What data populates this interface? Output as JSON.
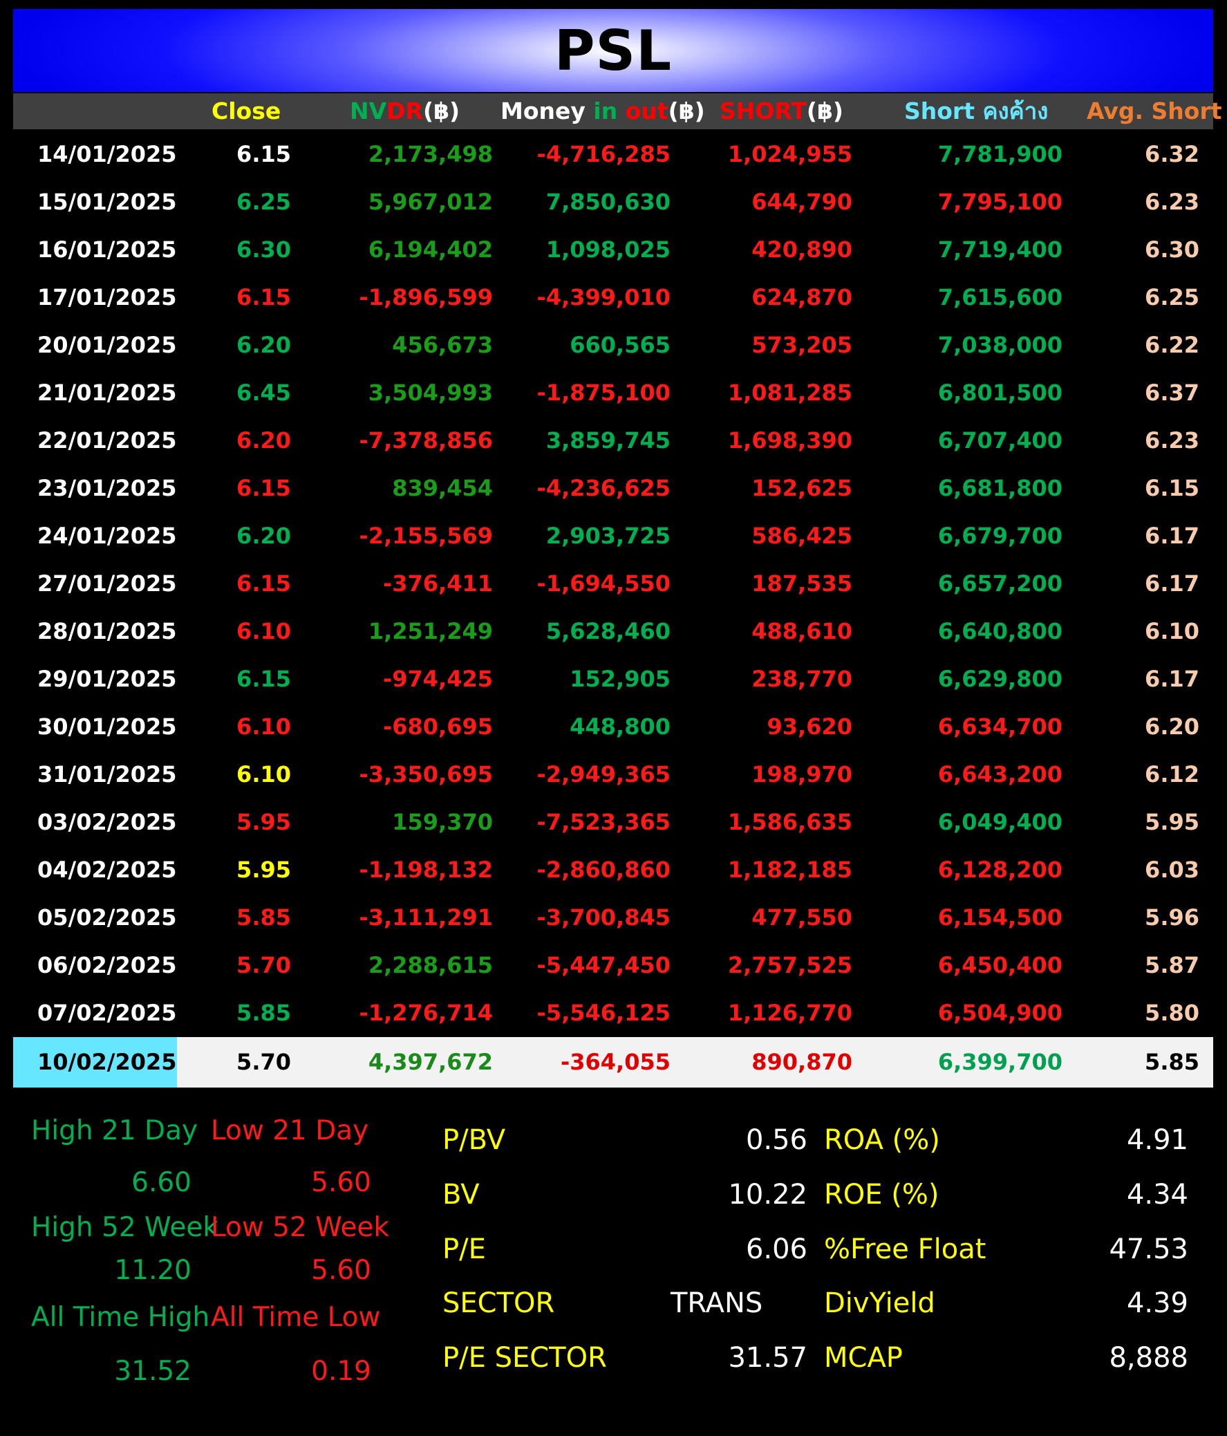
{
  "title": "PSL",
  "headers": {
    "close": "Close",
    "nvdr_a": "NV",
    "nvdr_b": "DR",
    "nvdr_c": "(฿)",
    "money_a": "Money ",
    "money_b": "in ",
    "money_c": "out",
    "money_d": "(฿)",
    "short_a": "SHORT",
    "short_b": "(฿)",
    "shortbal": "Short คงค้าง",
    "avg": "Avg. Short"
  },
  "rows": [
    {
      "date": "14/01/2025",
      "close": "6.15",
      "close_c": "w",
      "nvdr": "2,173,498",
      "nvdr_c": "g",
      "money": "-4,716,285",
      "money_c": "r",
      "short": "1,024,955",
      "shortbal": "7,781,900",
      "shortbal_c": "g",
      "avg": "6.32"
    },
    {
      "date": "15/01/2025",
      "close": "6.25",
      "close_c": "g",
      "nvdr": "5,967,012",
      "nvdr_c": "g",
      "money": "7,850,630",
      "money_c": "g",
      "short": "644,790",
      "shortbal": "7,795,100",
      "shortbal_c": "r",
      "avg": "6.23"
    },
    {
      "date": "16/01/2025",
      "close": "6.30",
      "close_c": "g",
      "nvdr": "6,194,402",
      "nvdr_c": "g",
      "money": "1,098,025",
      "money_c": "g",
      "short": "420,890",
      "shortbal": "7,719,400",
      "shortbal_c": "g",
      "avg": "6.30"
    },
    {
      "date": "17/01/2025",
      "close": "6.15",
      "close_c": "r",
      "nvdr": "-1,896,599",
      "nvdr_c": "r",
      "money": "-4,399,010",
      "money_c": "r",
      "short": "624,870",
      "shortbal": "7,615,600",
      "shortbal_c": "g",
      "avg": "6.25"
    },
    {
      "date": "20/01/2025",
      "close": "6.20",
      "close_c": "g",
      "nvdr": "456,673",
      "nvdr_c": "g",
      "money": "660,565",
      "money_c": "g",
      "short": "573,205",
      "shortbal": "7,038,000",
      "shortbal_c": "g",
      "avg": "6.22"
    },
    {
      "date": "21/01/2025",
      "close": "6.45",
      "close_c": "g",
      "nvdr": "3,504,993",
      "nvdr_c": "g",
      "money": "-1,875,100",
      "money_c": "r",
      "short": "1,081,285",
      "shortbal": "6,801,500",
      "shortbal_c": "g",
      "avg": "6.37"
    },
    {
      "date": "22/01/2025",
      "close": "6.20",
      "close_c": "r",
      "nvdr": "-7,378,856",
      "nvdr_c": "r",
      "money": "3,859,745",
      "money_c": "g",
      "short": "1,698,390",
      "shortbal": "6,707,400",
      "shortbal_c": "g",
      "avg": "6.23"
    },
    {
      "date": "23/01/2025",
      "close": "6.15",
      "close_c": "r",
      "nvdr": "839,454",
      "nvdr_c": "g",
      "money": "-4,236,625",
      "money_c": "r",
      "short": "152,625",
      "shortbal": "6,681,800",
      "shortbal_c": "g",
      "avg": "6.15"
    },
    {
      "date": "24/01/2025",
      "close": "6.20",
      "close_c": "g",
      "nvdr": "-2,155,569",
      "nvdr_c": "r",
      "money": "2,903,725",
      "money_c": "g",
      "short": "586,425",
      "shortbal": "6,679,700",
      "shortbal_c": "g",
      "avg": "6.17"
    },
    {
      "date": "27/01/2025",
      "close": "6.15",
      "close_c": "r",
      "nvdr": "-376,411",
      "nvdr_c": "r",
      "money": "-1,694,550",
      "money_c": "r",
      "short": "187,535",
      "shortbal": "6,657,200",
      "shortbal_c": "g",
      "avg": "6.17"
    },
    {
      "date": "28/01/2025",
      "close": "6.10",
      "close_c": "r",
      "nvdr": "1,251,249",
      "nvdr_c": "g",
      "money": "5,628,460",
      "money_c": "g",
      "short": "488,610",
      "shortbal": "6,640,800",
      "shortbal_c": "g",
      "avg": "6.10"
    },
    {
      "date": "29/01/2025",
      "close": "6.15",
      "close_c": "g",
      "nvdr": "-974,425",
      "nvdr_c": "r",
      "money": "152,905",
      "money_c": "g",
      "short": "238,770",
      "shortbal": "6,629,800",
      "shortbal_c": "g",
      "avg": "6.17"
    },
    {
      "date": "30/01/2025",
      "close": "6.10",
      "close_c": "r",
      "nvdr": "-680,695",
      "nvdr_c": "r",
      "money": "448,800",
      "money_c": "g",
      "short": "93,620",
      "shortbal": "6,634,700",
      "shortbal_c": "r",
      "avg": "6.20"
    },
    {
      "date": "31/01/2025",
      "close": "6.10",
      "close_c": "y",
      "nvdr": "-3,350,695",
      "nvdr_c": "r",
      "money": "-2,949,365",
      "money_c": "r",
      "short": "198,970",
      "shortbal": "6,643,200",
      "shortbal_c": "r",
      "avg": "6.12"
    },
    {
      "date": "03/02/2025",
      "close": "5.95",
      "close_c": "r",
      "nvdr": "159,370",
      "nvdr_c": "g",
      "money": "-7,523,365",
      "money_c": "r",
      "short": "1,586,635",
      "shortbal": "6,049,400",
      "shortbal_c": "g",
      "avg": "5.95"
    },
    {
      "date": "04/02/2025",
      "close": "5.95",
      "close_c": "y",
      "nvdr": "-1,198,132",
      "nvdr_c": "r",
      "money": "-2,860,860",
      "money_c": "r",
      "short": "1,182,185",
      "shortbal": "6,128,200",
      "shortbal_c": "r",
      "avg": "6.03"
    },
    {
      "date": "05/02/2025",
      "close": "5.85",
      "close_c": "r",
      "nvdr": "-3,111,291",
      "nvdr_c": "r",
      "money": "-3,700,845",
      "money_c": "r",
      "short": "477,550",
      "shortbal": "6,154,500",
      "shortbal_c": "r",
      "avg": "5.96"
    },
    {
      "date": "06/02/2025",
      "close": "5.70",
      "close_c": "r",
      "nvdr": "2,288,615",
      "nvdr_c": "g",
      "money": "-5,447,450",
      "money_c": "r",
      "short": "2,757,525",
      "shortbal": "6,450,400",
      "shortbal_c": "r",
      "avg": "5.87"
    },
    {
      "date": "07/02/2025",
      "close": "5.85",
      "close_c": "g",
      "nvdr": "-1,276,714",
      "nvdr_c": "r",
      "money": "-5,546,125",
      "money_c": "r",
      "short": "1,126,770",
      "shortbal": "6,504,900",
      "shortbal_c": "r",
      "avg": "5.80"
    }
  ],
  "latest": {
    "date": "10/02/2025",
    "close": "5.70",
    "nvdr": "4,397,672",
    "money": "-364,055",
    "short": "890,870",
    "shortbal": "6,399,700",
    "avg": "5.85"
  },
  "ranges": {
    "high21_label": "High 21 Day",
    "low21_label": "Low 21 Day",
    "high21": "6.60",
    "low21": "5.60",
    "high52_label": "High 52 Week",
    "low52_label": "Low 52 Week",
    "high52": "11.20",
    "low52": "5.60",
    "ath_label": "All Time High",
    "atl_label": "All Time Low",
    "ath": "31.52",
    "atl": "0.19"
  },
  "fundamentals": {
    "pbv_label": "P/BV",
    "pbv": "0.56",
    "bv_label": "BV",
    "bv": "10.22",
    "pe_label": "P/E",
    "pe": "6.06",
    "sector_label": "SECTOR",
    "sector": "TRANS",
    "pe_sector_label": "P/E SECTOR",
    "pe_sector": "31.57",
    "roa_label": "ROA (%)",
    "roa": "4.91",
    "roe_label": "ROE (%)",
    "roe": "4.34",
    "float_label": "%Free Float",
    "float": "47.53",
    "div_label": "DivYield",
    "div": "4.39",
    "mcap_label": "MCAP",
    "mcap": "8,888"
  }
}
